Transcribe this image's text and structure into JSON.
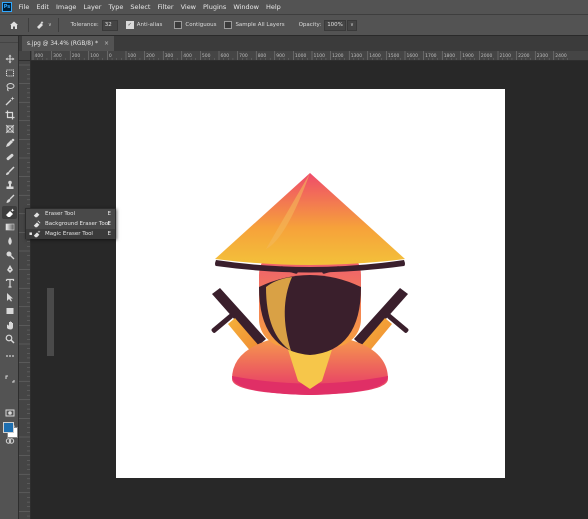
{
  "app": {
    "logo_text": "Ps"
  },
  "menu": [
    "File",
    "Edit",
    "Image",
    "Layer",
    "Type",
    "Select",
    "Filter",
    "View",
    "Plugins",
    "Window",
    "Help"
  ],
  "options": {
    "tolerance_label": "Tolerance:",
    "tolerance_value": "32",
    "antialias_label": "Anti-alias",
    "antialias_checked": true,
    "contiguous_label": "Contiguous",
    "contiguous_checked": false,
    "sample_all_label": "Sample All Layers",
    "sample_all_checked": false,
    "opacity_label": "Opacity:",
    "opacity_value": "100%"
  },
  "document": {
    "tab_title": "s.jpg @ 34.4% (RGB/8) *",
    "close_glyph": "×"
  },
  "ruler_labels": [
    "400",
    "300",
    "200",
    "100",
    "0",
    "100",
    "200",
    "300",
    "400",
    "500",
    "600",
    "700",
    "800",
    "900",
    "1000",
    "1100",
    "1200",
    "1300",
    "1400",
    "1500",
    "1600",
    "1700",
    "1800",
    "1900",
    "2000",
    "2100",
    "2200",
    "2300",
    "2400"
  ],
  "flyout": {
    "items": [
      {
        "label": "Eraser Tool",
        "shortcut": "E",
        "icon": "eraser-icon",
        "selected": false
      },
      {
        "label": "Background Eraser Tool",
        "shortcut": "E",
        "icon": "background-eraser-icon",
        "selected": false
      },
      {
        "label": "Magic Eraser Tool",
        "shortcut": "E",
        "icon": "magic-eraser-icon",
        "selected": true
      }
    ]
  },
  "tools": [
    "move-icon",
    "marquee-icon",
    "lasso-icon",
    "magic-wand-icon",
    "crop-icon",
    "frame-icon",
    "eyedropper-icon",
    "healing-icon",
    "brush-icon",
    "stamp-icon",
    "history-brush-icon",
    "eraser-icon",
    "gradient-icon",
    "blur-icon",
    "dodge-icon",
    "pen-icon",
    "type-icon",
    "path-selection-icon",
    "rectangle-icon",
    "hand-icon",
    "zoom-icon",
    "more-icon"
  ],
  "colors": {
    "foreground": "#1e6fb0",
    "background": "#ffffff",
    "canvas": "#ffffff",
    "workspace": "#282828",
    "panel": "#535353"
  }
}
